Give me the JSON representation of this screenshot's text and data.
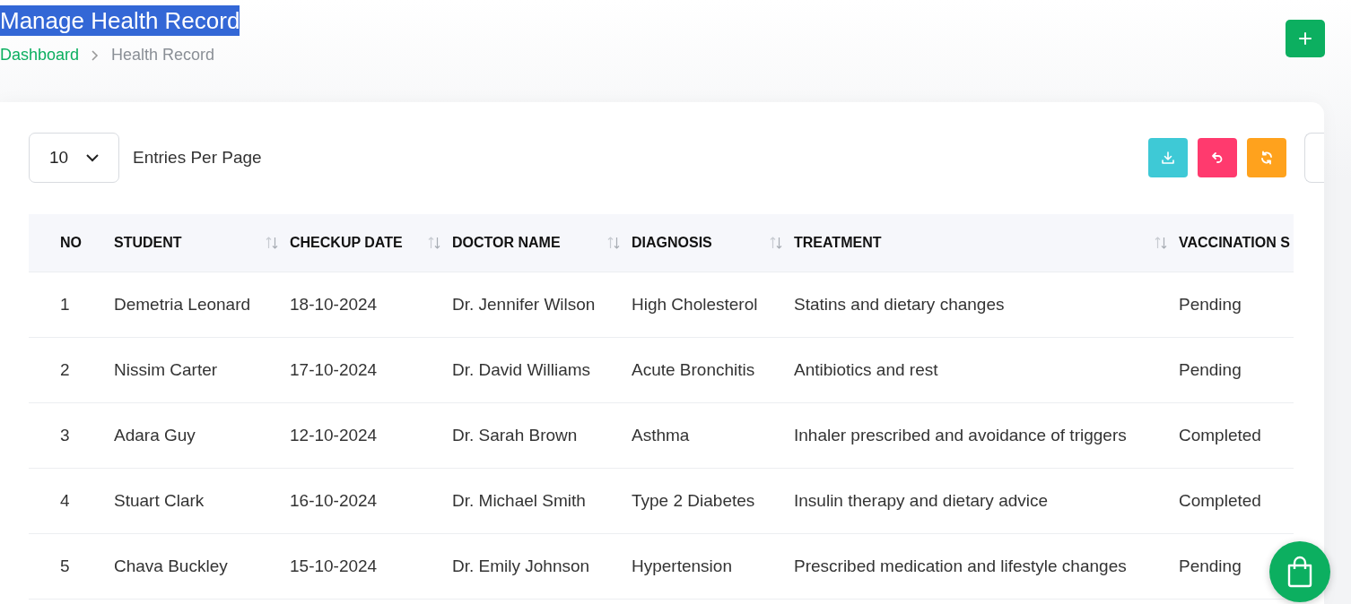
{
  "header": {
    "title": "Manage Health Record",
    "title_text_selected": true,
    "breadcrumb": [
      {
        "label": "Dashboard",
        "kind": "link"
      },
      {
        "label": "Health Record",
        "kind": "current"
      }
    ]
  },
  "toolbar": {
    "entries_value": "10",
    "entries_label": "Entries Per Page",
    "buttons": [
      {
        "kind": "download",
        "color": "#3ec9d6"
      },
      {
        "kind": "undo",
        "color": "#ff3a6e"
      },
      {
        "kind": "refresh",
        "color": "#ffa21d"
      }
    ]
  },
  "table": {
    "columns": [
      {
        "label": "NO",
        "sortable": false
      },
      {
        "label": "STUDENT",
        "sortable": true
      },
      {
        "label": "CHECKUP DATE",
        "sortable": true
      },
      {
        "label": "DOCTOR NAME",
        "sortable": true
      },
      {
        "label": "DIAGNOSIS",
        "sortable": true
      },
      {
        "label": "TREATMENT",
        "sortable": true
      },
      {
        "label": "VACCINATION S",
        "sortable": false
      }
    ],
    "rows": [
      [
        "1",
        "Demetria Leonard",
        "18-10-2024",
        "Dr. Jennifer Wilson",
        "High Cholesterol",
        "Statins and dietary changes",
        "Pending"
      ],
      [
        "2",
        "Nissim Carter",
        "17-10-2024",
        "Dr. David Williams",
        "Acute Bronchitis",
        "Antibiotics and rest",
        "Pending"
      ],
      [
        "3",
        "Adara Guy",
        "12-10-2024",
        "Dr. Sarah Brown",
        "Asthma",
        "Inhaler prescribed and avoidance of triggers",
        "Completed"
      ],
      [
        "4",
        "Stuart Clark",
        "16-10-2024",
        "Dr. Michael Smith",
        "Type 2 Diabetes",
        "Insulin therapy and dietary advice",
        "Completed"
      ],
      [
        "5",
        "Chava Buckley",
        "15-10-2024",
        "Dr. Emily Johnson",
        "Hypertension",
        "Prescribed medication and lifestyle changes",
        "Pending"
      ]
    ]
  }
}
